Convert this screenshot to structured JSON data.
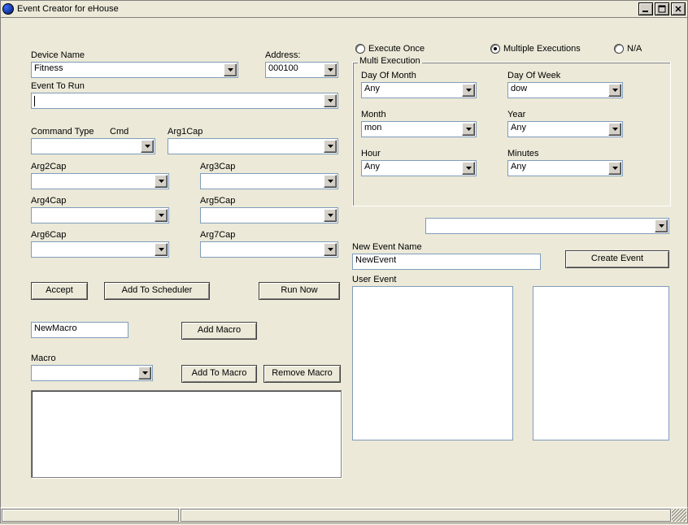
{
  "window": {
    "title": "Event Creator for eHouse"
  },
  "left": {
    "device_name_label": "Device Name",
    "device_name_value": "Fitness",
    "address_label": "Address:",
    "address_value": "000100",
    "event_to_run_label": "Event To Run",
    "event_to_run_value": "",
    "command_type_label": "Command Type",
    "cmd_label": "Cmd",
    "arg1_label": "Arg1Cap",
    "arg2_label": "Arg2Cap",
    "arg3_label": "Arg3Cap",
    "arg4_label": "Arg4Cap",
    "arg5_label": "Arg5Cap",
    "arg6_label": "Arg6Cap",
    "arg7_label": "Arg7Cap",
    "accept_btn": "Accept",
    "add_scheduler_btn": "Add To Scheduler",
    "run_now_btn": "Run Now",
    "new_macro_value": "NewMacro",
    "add_macro_btn": "Add Macro",
    "macro_label": "Macro",
    "add_to_macro_btn": "Add To Macro",
    "remove_macro_btn": "Remove Macro"
  },
  "exec": {
    "execute_once": "Execute Once",
    "multiple_executions": "Multiple Executions",
    "na": "N/A",
    "group_title": "Multi Execution",
    "day_of_month_label": "Day Of Month",
    "day_of_month_value": "Any",
    "day_of_week_label": "Day Of Week",
    "day_of_week_value": "dow",
    "month_label": "Month",
    "month_value": "mon",
    "year_label": "Year",
    "year_value": "Any",
    "hour_label": "Hour",
    "hour_value": "Any",
    "minutes_label": "Minutes",
    "minutes_value": "Any"
  },
  "right": {
    "new_event_name_label": "New Event Name",
    "new_event_name_value": "NewEvent",
    "create_event_btn": "Create Event",
    "user_event_label": "User Event"
  }
}
